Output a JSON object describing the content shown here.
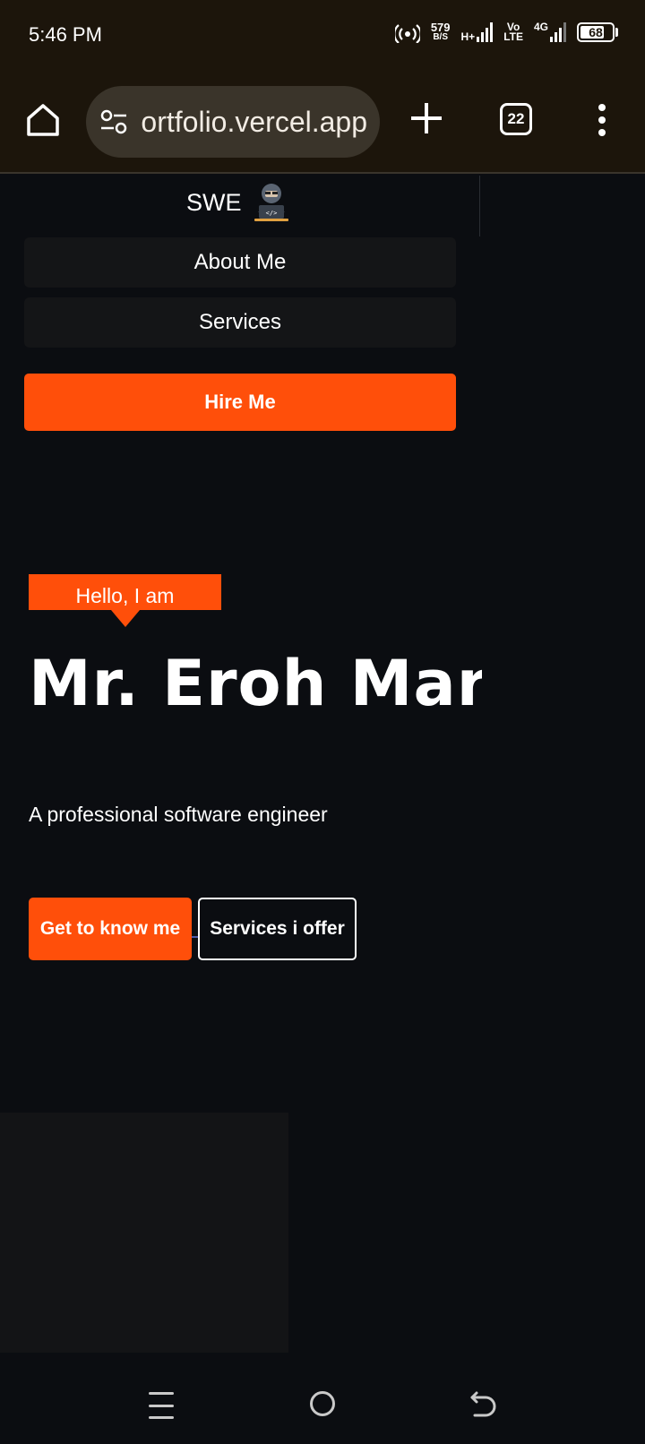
{
  "status_bar": {
    "time": "5:46 PM",
    "net_speed_value": "579",
    "net_speed_unit": "B/S",
    "network_type": "H+",
    "volte_line1": "Vo",
    "volte_line2": "LTE",
    "network_type_2": "4G",
    "battery_level": "68",
    "icons": [
      "hotspot-icon",
      "signal-icon",
      "signal-icon",
      "battery-icon"
    ]
  },
  "browser": {
    "url": "portfolio.vercel.app",
    "tab_count": "22",
    "icons": [
      "home-icon",
      "site-settings-icon",
      "plus-icon",
      "menu-dots-icon"
    ]
  },
  "nav": {
    "brand_text": "SWE",
    "brand_icon": "hacker-laptop-icon",
    "items": [
      {
        "label": "About Me"
      },
      {
        "label": "Services"
      }
    ],
    "hire_label": "Hire Me"
  },
  "hero": {
    "greeting": "Hello, I am",
    "name": "Mr. Eroh Marc",
    "tagline": "A professional software engineer",
    "primary_button": "Get to know me",
    "secondary_button": "Services i offer"
  },
  "colors": {
    "accent": "#ff4f0a",
    "page_background": "#0b0d11",
    "browser_chrome": "#1c150b",
    "nav_item_background": "#141517"
  },
  "system_nav": {
    "icons": [
      "recents-icon",
      "home-circle-icon",
      "back-icon"
    ]
  }
}
